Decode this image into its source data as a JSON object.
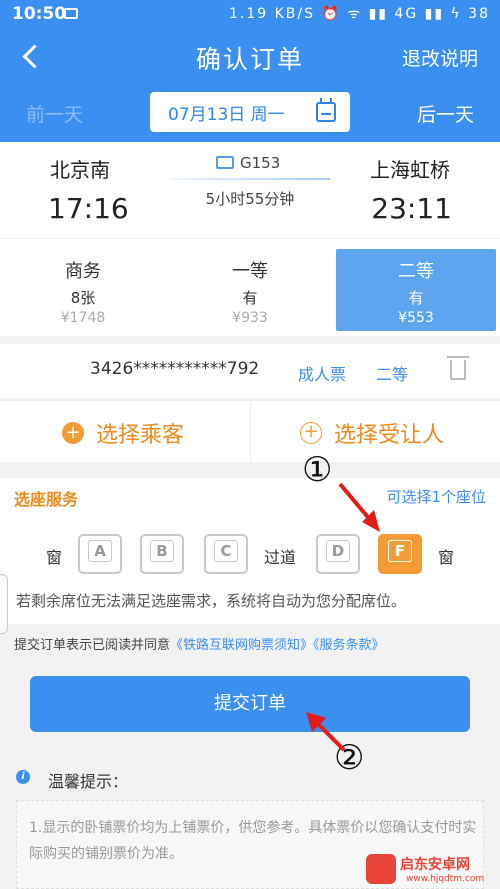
{
  "status_bar": {
    "time": "10:50",
    "indicators": "1.19 KB/S ⏰ ᯤ ▮▮ 4G ▮▮ ϟ 38"
  },
  "header": {
    "title": "确认订单",
    "refund_link": "退改说明"
  },
  "date_bar": {
    "prev": "前一天",
    "date": "07月13日 周一",
    "next": "后一天"
  },
  "train": {
    "from": "北京南",
    "to": "上海虹桥",
    "departure": "17:16",
    "arrival": "23:11",
    "number": "G153",
    "duration": "5小时55分钟"
  },
  "seat_types": [
    {
      "name": "商务",
      "count": "8张",
      "price": "¥1748",
      "selected": false
    },
    {
      "name": "一等",
      "count": "有",
      "price": "¥933",
      "selected": false
    },
    {
      "name": "二等",
      "count": "有",
      "price": "¥553",
      "selected": true
    }
  ],
  "passenger": {
    "id": "3426***********792",
    "type": "成人票",
    "class": "二等"
  },
  "choose": {
    "passenger": "选择乘客",
    "yield": "选择受让人"
  },
  "seat_service": {
    "title": "选座服务",
    "hint": "可选择1个座位",
    "window_left": "窗",
    "aisle": "过道",
    "window_right": "窗",
    "seats": [
      "A",
      "B",
      "C",
      "D",
      "F"
    ],
    "active_seat": "F",
    "notice": "若剩余席位无法满足选座需求，系统将自动为您分配席位。"
  },
  "agreement": {
    "prefix": "提交订单表示已阅读并同意",
    "link": "《铁路互联网购票须知》《服务条款》"
  },
  "submit": {
    "label": "提交订单"
  },
  "tips": {
    "title": "温馨提示：",
    "text": "1.显示的卧铺票价均为上铺票价，供您参考。具体票价以您确认支付时实际购买的铺别票价为准。"
  },
  "annotations": {
    "one": "①",
    "two": "②"
  },
  "watermark": {
    "name": "启东安卓网",
    "url": "www.hjqdtm.com"
  },
  "colors": {
    "primary": "#3b8ff0",
    "accent": "#f08a1c"
  }
}
